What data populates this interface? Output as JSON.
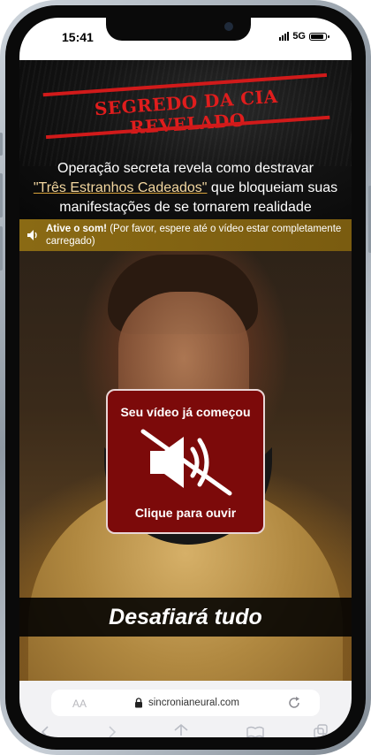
{
  "status_bar": {
    "time": "15:41",
    "network": "5G"
  },
  "header": {
    "stamp_text": "SEGREDO DA CIA REVELADO",
    "headline_before": "Operação secreta revela como destravar",
    "headline_highlight": "\"Três Estranhos Cadeados\"",
    "headline_after": " que bloqueiam suas manifestações de se tornarem realidade"
  },
  "video": {
    "sound_banner_bold": "Ative o som!",
    "sound_banner_text": " (Por favor, espere até o vídeo estar completamente carregado)",
    "overlay_title": "Seu vídeo já começou",
    "overlay_action": "Clique para ouvir",
    "caption": "Desafiará tudo"
  },
  "browser": {
    "text_size_label": "AA",
    "url": "sincronianeural.com"
  },
  "colors": {
    "stamp_red": "#e01d1d",
    "banner_gold": "#8a6a14",
    "overlay_red": "#7c0a0a"
  }
}
